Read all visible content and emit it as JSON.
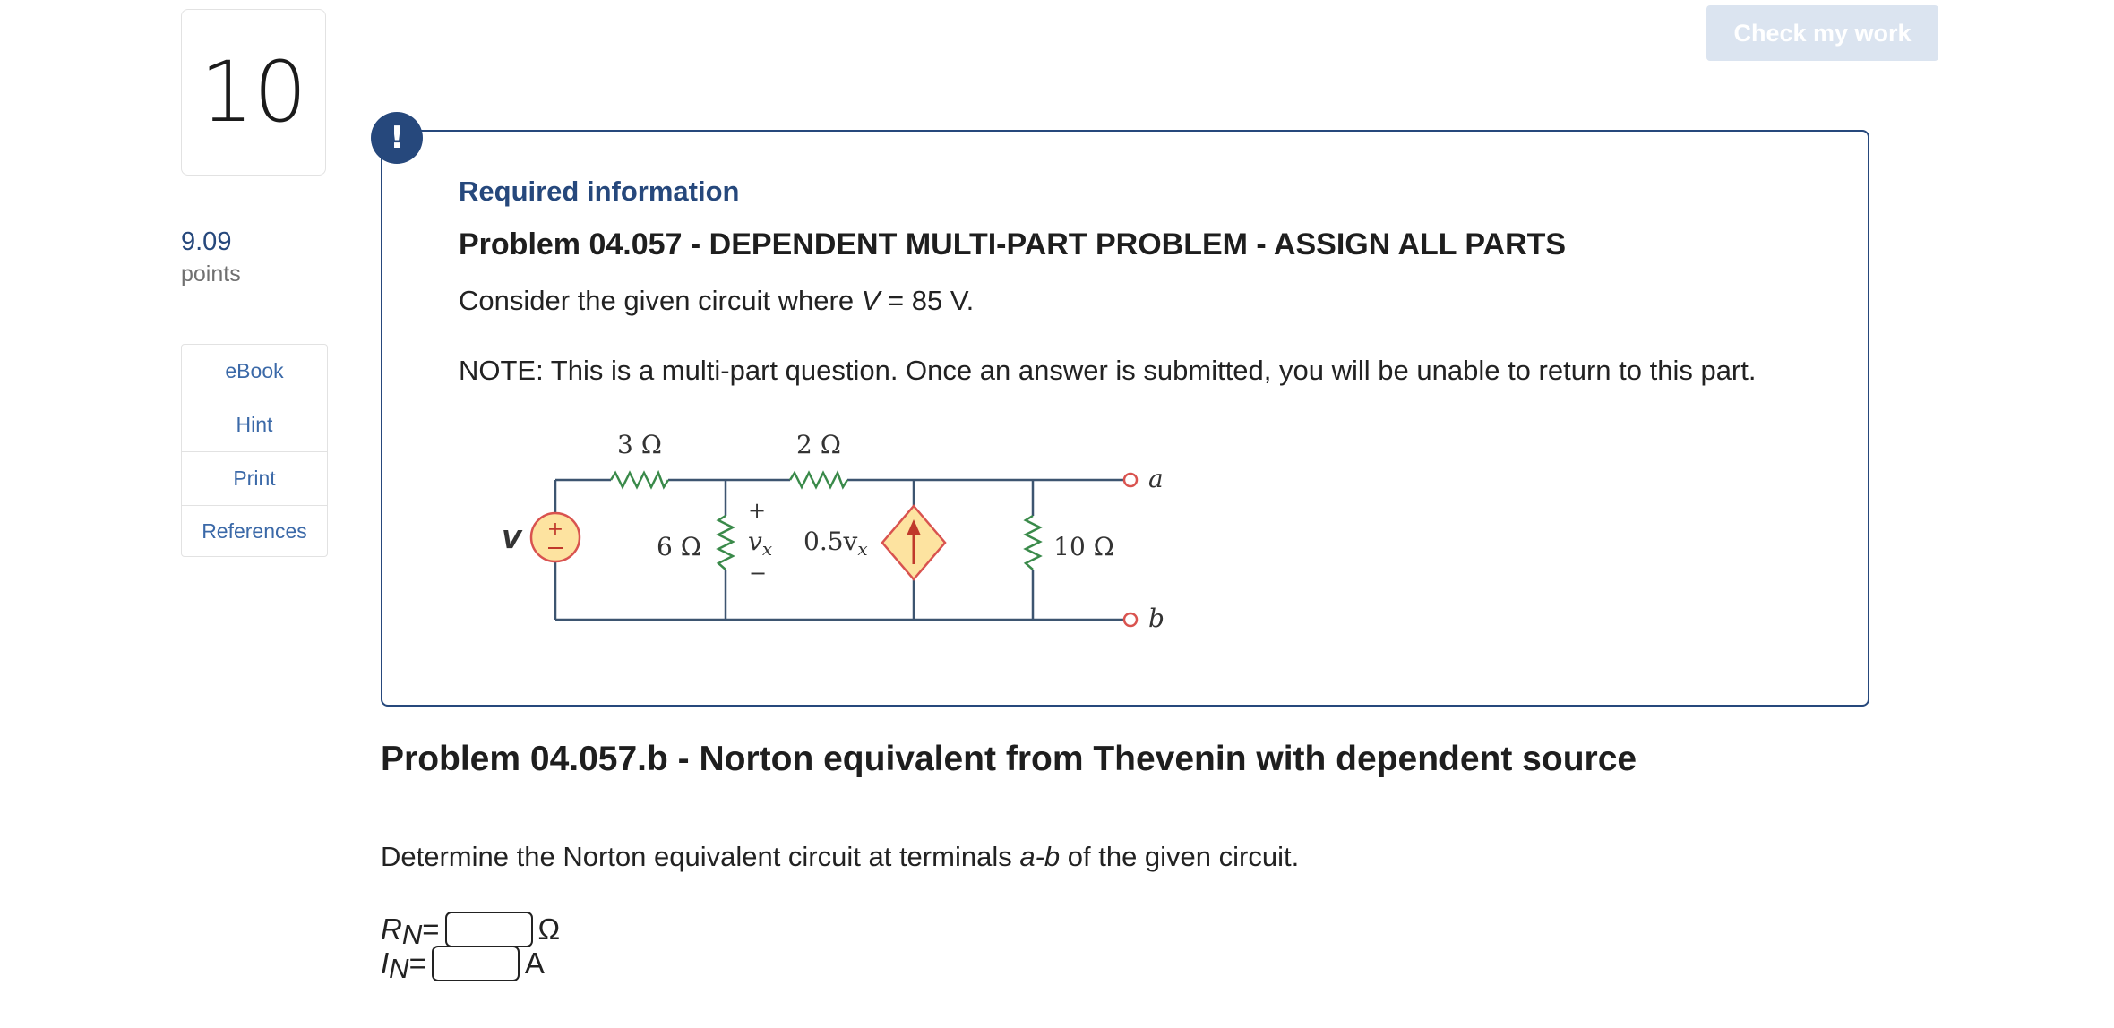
{
  "question": {
    "number": "10",
    "points_value": "9.09",
    "points_label": "points"
  },
  "sidebar": {
    "items": [
      {
        "label": "eBook"
      },
      {
        "label": "Hint"
      },
      {
        "label": "Print"
      },
      {
        "label": "References"
      }
    ]
  },
  "toolbar": {
    "check_label": "Check my work"
  },
  "required": {
    "icon": "!",
    "heading": "Required information",
    "problem_title": "Problem 04.057 - DEPENDENT MULTI-PART PROBLEM - ASSIGN ALL PARTS",
    "consider_prefix": "Consider the given circuit where ",
    "consider_var": "V",
    "consider_suffix": " = 85 V.",
    "note": "NOTE: This is a multi-part question. Once an answer is submitted, you will be unable to return to this part."
  },
  "circuit": {
    "r1": "3 Ω",
    "r2": "2 Ω",
    "r3": "6 Ω",
    "r4": "10 Ω",
    "source_label": "V",
    "vx": "v",
    "vx_sub": "x",
    "dep_coef": "0.5v",
    "dep_sub": "x",
    "plus": "+",
    "minus": "−",
    "terminal_a": "a",
    "terminal_b": "b",
    "colors": {
      "wire": "#3d5570",
      "source_fill": "#fde3a0",
      "source_stroke": "#d9534f",
      "resistor": "#3a8a4a",
      "arrow": "#c0392b"
    }
  },
  "part": {
    "title": "Problem 04.057.b - Norton equivalent from Thevenin with dependent source",
    "instruction_prefix": "Determine the Norton equivalent circuit at terminals ",
    "instruction_terms": "a-b",
    "instruction_suffix": " of the given circuit.",
    "rn_var": "R",
    "rn_sub": "N",
    "rn_eq": " =",
    "rn_unit": "Ω",
    "rn_value": "",
    "in_var": "I",
    "in_sub": "N",
    "in_eq": " =",
    "in_unit": "A",
    "in_value": ""
  }
}
